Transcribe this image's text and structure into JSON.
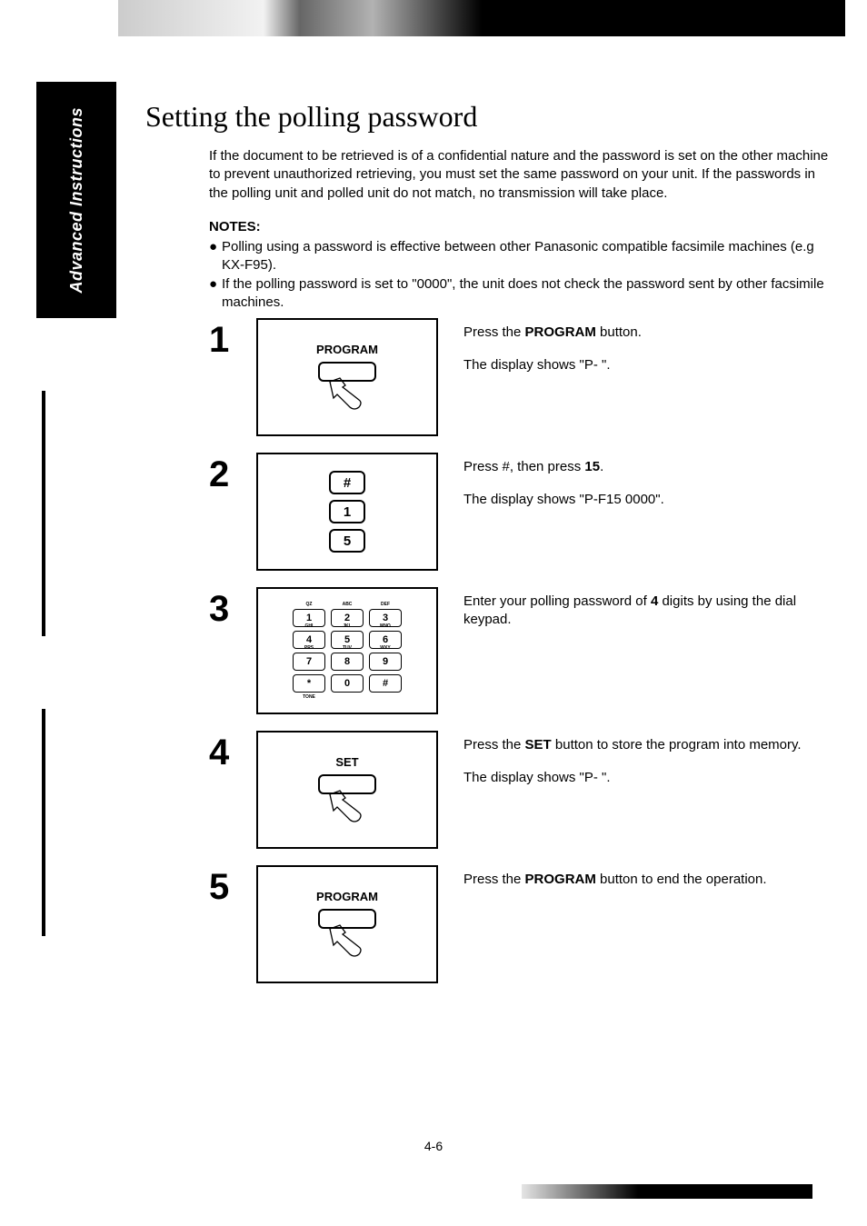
{
  "side_tab": "Advanced Instructions",
  "title": "Setting the polling password",
  "intro": "If the document to be retrieved is of a confidential nature and the password is set on the other machine to prevent unauthorized retrieving, you must set the same password on your unit. If the passwords in the polling unit and polled unit do not match, no transmission will take place.",
  "notes_heading": "NOTES:",
  "notes": [
    "Polling using a password is effective between other Panasonic compatible facsimile machines (e.g KX-F95).",
    "If the polling password is set to \"0000\", the unit does not check the password sent by other facsimile machines."
  ],
  "steps": [
    {
      "num": "1",
      "diagram_label": "PROGRAM",
      "desc_lines": [
        {
          "pre": "Press the ",
          "bold": "PROGRAM",
          "post": " button."
        },
        {
          "pre": "The display shows \"P-   \".",
          "bold": "",
          "post": ""
        }
      ]
    },
    {
      "num": "2",
      "keys": [
        "#",
        "1",
        "5"
      ],
      "desc_lines": [
        {
          "pre": "Press #, then press ",
          "bold": "15",
          "post": "."
        },
        {
          "pre": "The display shows \"P-F15  0000\".",
          "bold": "",
          "post": ""
        }
      ]
    },
    {
      "num": "3",
      "keypad": [
        {
          "k": "1",
          "l": "QZ"
        },
        {
          "k": "2",
          "l": "ABC"
        },
        {
          "k": "3",
          "l": "DEF"
        },
        {
          "k": "4",
          "l": "GHI"
        },
        {
          "k": "5",
          "l": "JKL"
        },
        {
          "k": "6",
          "l": "MNO"
        },
        {
          "k": "7",
          "l": "PRS"
        },
        {
          "k": "8",
          "l": "TUV"
        },
        {
          "k": "9",
          "l": "WXY"
        },
        {
          "k": "*",
          "l": "",
          "b": "TONE"
        },
        {
          "k": "0",
          "l": ""
        },
        {
          "k": "#",
          "l": ""
        }
      ],
      "desc_lines": [
        {
          "pre": "Enter your polling password of ",
          "bold": "4",
          "post": " digits by using the dial keypad."
        }
      ]
    },
    {
      "num": "4",
      "diagram_label": "SET",
      "desc_lines": [
        {
          "pre": "Press the ",
          "bold": "SET",
          "post": " button to store the program into memory."
        },
        {
          "pre": "The display shows \"P-   \".",
          "bold": "",
          "post": ""
        }
      ]
    },
    {
      "num": "5",
      "diagram_label": "PROGRAM",
      "desc_lines": [
        {
          "pre": "Press the ",
          "bold": "PROGRAM",
          "post": " button to end the operation."
        }
      ]
    }
  ],
  "page_number": "4-6"
}
